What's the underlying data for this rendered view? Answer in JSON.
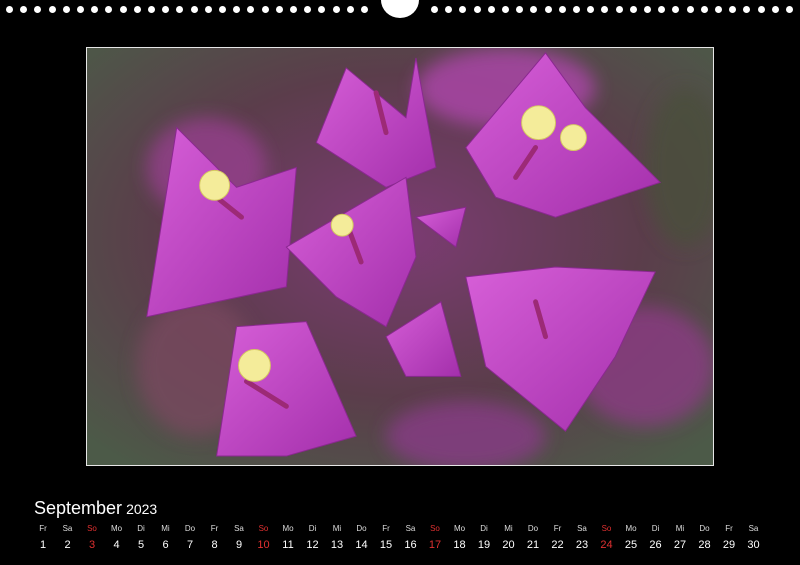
{
  "calendar": {
    "month": "September",
    "year": "2023",
    "weekdays": [
      "Fr",
      "Sa",
      "So",
      "Mo",
      "Di",
      "Mi",
      "Do",
      "Fr",
      "Sa",
      "So",
      "Mo",
      "Di",
      "Mi",
      "Do",
      "Fr",
      "Sa",
      "So",
      "Mo",
      "Di",
      "Mi",
      "Do",
      "Fr",
      "Sa",
      "So",
      "Mo",
      "Di",
      "Mi",
      "Do",
      "Fr",
      "Sa"
    ],
    "days": [
      "1",
      "2",
      "3",
      "4",
      "5",
      "6",
      "7",
      "8",
      "9",
      "10",
      "11",
      "12",
      "13",
      "14",
      "15",
      "16",
      "17",
      "18",
      "19",
      "20",
      "21",
      "22",
      "23",
      "24",
      "25",
      "26",
      "27",
      "28",
      "29",
      "30"
    ],
    "sunday_color": "#e03030"
  },
  "photo": {
    "subject": "bougainvillea-flowers",
    "bract_color": "#c040c8",
    "flower_color": "#f4ec9a"
  }
}
